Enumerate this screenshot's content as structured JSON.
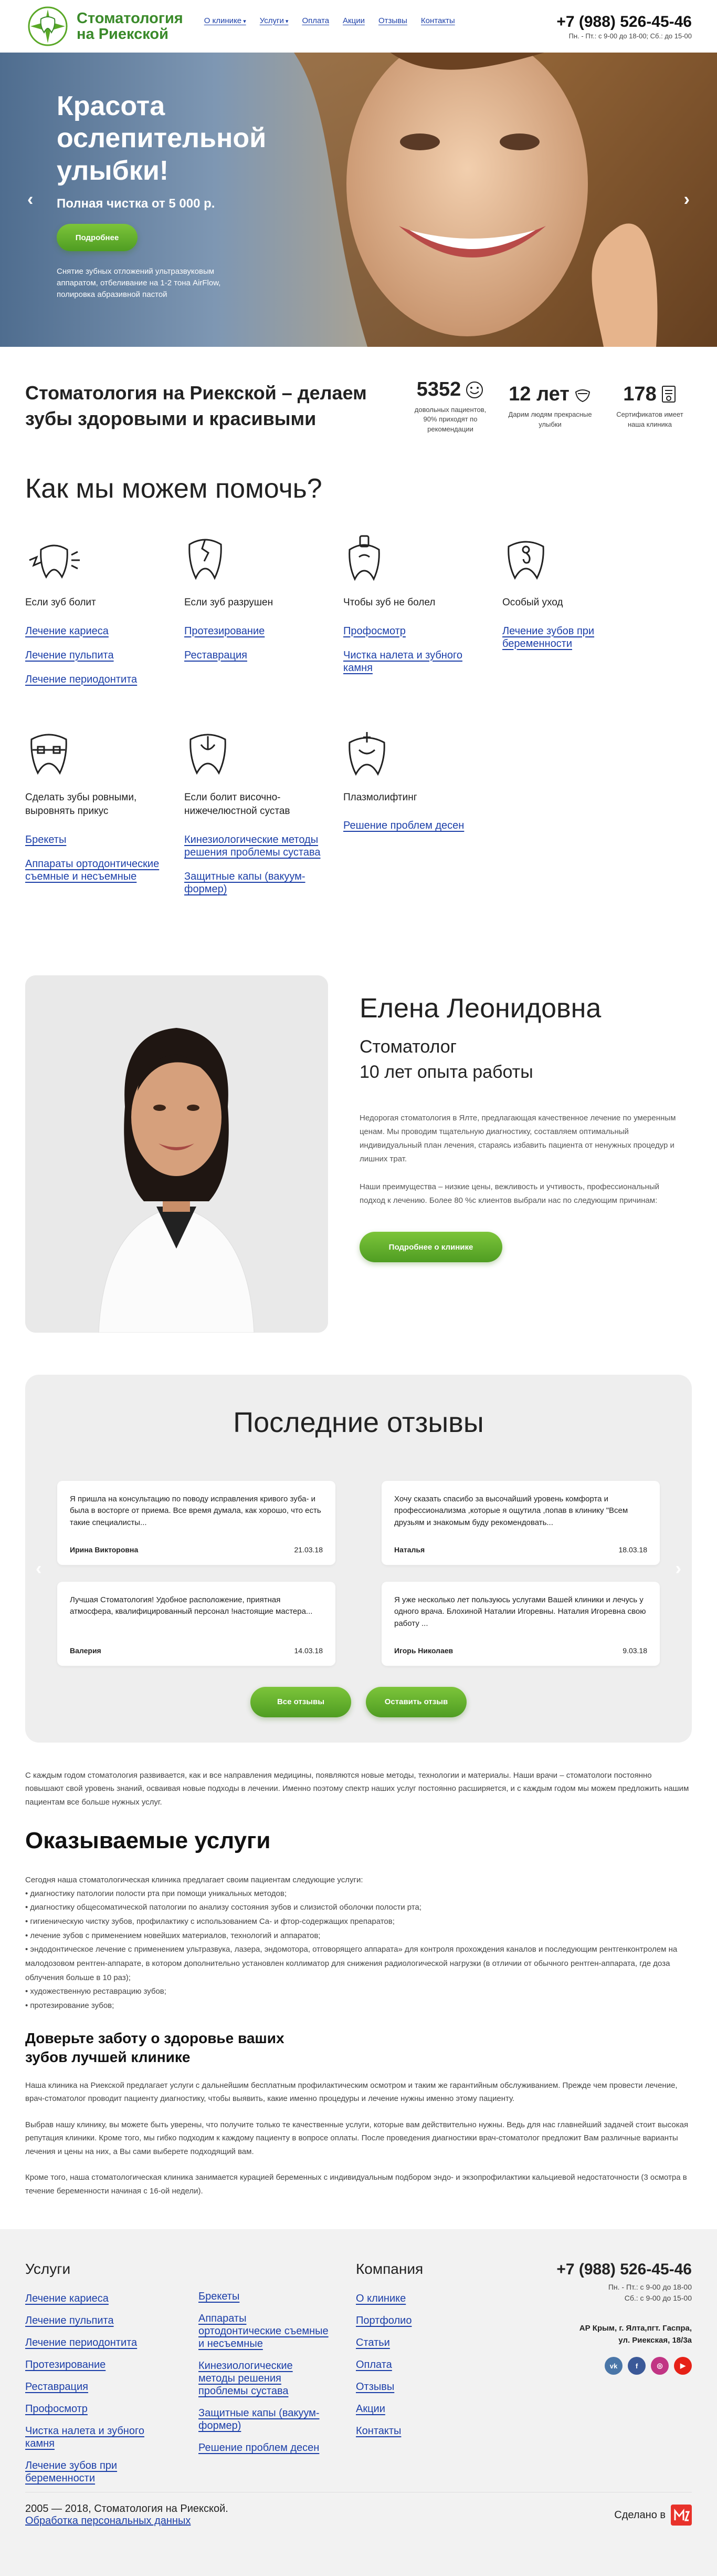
{
  "header": {
    "logo_line1": "Стоматология",
    "logo_line2": "на Риекской",
    "nav": [
      {
        "label": "О клинике",
        "dropdown": true
      },
      {
        "label": "Услуги",
        "dropdown": true
      },
      {
        "label": "Оплата",
        "dropdown": false
      },
      {
        "label": "Акции",
        "dropdown": false
      },
      {
        "label": "Отзывы",
        "dropdown": false
      },
      {
        "label": "Контакты",
        "dropdown": false
      }
    ],
    "phone": "+7 (988) 526-45-46",
    "hours": "Пн. - Пт.: с 9-00 до 18-00; Сб.: до 15-00"
  },
  "hero": {
    "title": "Красота ослепительной улыбки!",
    "subtitle": "Полная чистка от 5 000 р.",
    "button": "Подробнее",
    "description": "Снятие зубных отложений ультразвуковым аппаратом, отбеливание на 1-2 тона AirFlow, полировка абразивной пастой",
    "arrow_left": "‹",
    "arrow_right": "›"
  },
  "stats": {
    "heading": "Стоматология на Риекской – делаем зубы здоровыми и красивыми",
    "items": [
      {
        "num": "5352",
        "caption": "довольных пациентов, 90% приходят по рекомендации"
      },
      {
        "num": "12 лет",
        "caption": "Дарим людям прекрасные улыбки"
      },
      {
        "num": "178",
        "caption": "Сертификатов имеет наша клиника"
      }
    ]
  },
  "help": {
    "heading": "Как мы можем помочь?",
    "items": [
      {
        "title": "Если зуб болит",
        "icon": "tooth-pain-icon",
        "links": [
          "Лечение кариеса",
          "Лечение пульпита",
          "Лечение периодонтита"
        ]
      },
      {
        "title": "Если зуб разрушен",
        "icon": "broken-tooth-icon",
        "links": [
          "Протезирование",
          "Реставрация"
        ]
      },
      {
        "title": "Чтобы зуб не болел",
        "icon": "tooth-care-icon",
        "links": [
          "Профосмотр",
          "Чистка налета и зубного камня"
        ]
      },
      {
        "title": "Особый уход",
        "icon": "pregnancy-icon",
        "links": [
          "Лечение зубов при беременности"
        ]
      },
      {
        "title": "Сделать зубы ровными, выровнять прикус",
        "icon": "braces-icon",
        "links": [
          "Брекеты",
          "Аппараты ортодонтические съемные и несъемные"
        ]
      },
      {
        "title": "Если болит височно-нижечелюстной сустав",
        "icon": "jaw-icon",
        "links": [
          "Кинезиологические методы решения проблемы сустава",
          "Защитные капы (вакуум-формер)"
        ]
      },
      {
        "title": "Плазмолифтинг",
        "icon": "plasma-icon",
        "links": [
          "Решение проблем десен"
        ]
      }
    ]
  },
  "doctor": {
    "name": "Елена Леонидовна",
    "role": "Стоматолог",
    "experience": "10 лет опыта работы",
    "p1": "Недорогая стоматология в Ялте, предлагающая качественное лечение по умеренным ценам. Мы проводим тщательную диагностику, составляем оптимальный индивидуальный план лечения, стараясь избавить пациента от ненужных процедур и лишних трат.",
    "p2": "Наши преимущества – низкие цены, вежливость и учтивость, профессиональный подход к лечению. Более 80 %с клиентов выбрали нас по следующим причинам:",
    "button": "Подробнее о клинике"
  },
  "reviews": {
    "heading": "Последние отзывы",
    "items": [
      {
        "text": "Я пришла на консультацию по поводу исправления кривого зуба- и была в восторге от приема. Все время думала, как хорошо, что есть такие специалисты...",
        "name": "Ирина Викторовна",
        "date": "21.03.18"
      },
      {
        "text": "Хочу сказать спасибо за высочайший уровень комфорта и профессионализма ,которые я ощутила ,попав в клинику \"Всем друзьям и знакомым буду рекомендовать...",
        "name": "Наталья",
        "date": "18.03.18"
      },
      {
        "text": "Лучшая Стоматология! Удобное расположение, приятная атмосфера, квалифицированный персонал !наcтоящие мастера...",
        "name": "Валерия",
        "date": "14.03.18"
      },
      {
        "text": "Я уже несколько лет пользуюсь услугами Вашей клиники и лечусь у одного врача. Блохиной Наталии Игоревны. Наталия Игоревна свою работу ...",
        "name": "Игорь Николаев",
        "date": "9.03.18"
      }
    ],
    "btn_all": "Все отзывы",
    "btn_leave": "Оставить отзыв"
  },
  "article": {
    "intro": "С каждым годом стоматология развивается, как и все направления медицины, появляются новые методы, технологии и материалы. Наши врачи – стоматологи постоянно повышают свой уровень знаний, осваивая новые подходы в лечении. Именно поэтому спектр наших услуг постоянно расширяется, и с каждым годом мы можем предложить нашим пациентам все больше нужных услуг.",
    "heading": "Оказываемые услуги",
    "list_intro": "Сегодня наша стоматологическая клиника предлагает своим пациентам следующие услуги:",
    "list": [
      "• диагностику патологии полости рта при помощи уникальных методов;",
      "• диагностику общесоматической патологии по анализу состояния зубов и слизистой оболочки полости рта;",
      "• гигиеническую чистку зубов, профилактику с использованием Ca- и фтор-содержащих препаратов;",
      "• лечение зубов с применением новейших материалов, технологий и аппаратов;",
      "• эндодонтическое лечение с применением ультразвука, лазера, эндомотора, отговорящего аппарата» для контроля прохождения каналов и последующим рентгенконтролем на малодозовом рентген-аппарате, в котором дополнительно установлен коллиматор для снижения радиологической нагрузки (в отличии от обычного рентген-аппарата, где доза облучения больше в 10 раз);",
      "• художественную реставрацию зубов;",
      "• протезирование зубов;"
    ],
    "subheading": "Доверьте заботу о здоровье ваших зубов лучшей клинике",
    "p1": "Наша клиника на Риекской предлагает услуги с дальнейшим бесплатным профилактическим осмотром и таким же гарантийным обслуживанием. Прежде чем провести лечение, врач-стоматолог проводит пациенту диагностику, чтобы выявить, какие именно процедуры и лечение нужны именно этому пациенту.",
    "p2": "Выбрав нашу клинику, вы можете быть уверены, что получите только те качественные услуги, которые вам действительно нужны. Ведь для нас главнейший задачей стоит высокая репутация клиники. Кроме того, мы гибко подходим к каждому пациенту в вопросе оплаты. После проведения диагностики врач-стоматолог предложит Вам различные варианты лечения и цены на них, а Вы сами выберете подходящий вам.",
    "p3": "Кроме того, наша стоматологическая клиника занимается курацией беременных с индивидуальным подбором эндо- и экзопрофилактики кальциевой недостаточности (3 осмотра в течение беременности начиная с 16-ой недели)."
  },
  "footer": {
    "services_heading": "Услуги",
    "col1": [
      "Лечение кариеса",
      "Лечение пульпита",
      "Лечение периодонтита",
      "Протезирование",
      "Реставрация",
      "Профосмотр",
      "Чистка налета и зубного камня",
      "Лечение зубов при беременности"
    ],
    "col2": [
      "Брекеты",
      "Аппараты ортодонтические съемные и несъемные",
      "Кинезиологические методы решения проблемы сустава",
      "Защитные капы (вакуум-формер)",
      "Решение проблем десен"
    ],
    "company_heading": "Компания",
    "col3": [
      "О клинике",
      "Портфолио",
      "Статьи",
      "Оплата",
      "Отзывы",
      "Акции",
      "Контакты"
    ],
    "phone": "+7 (988) 526-45-46",
    "hours1": "Пн. - Пт.: с 9-00 до 18-00",
    "hours2": "Сб.: с 9-00 до 15-00",
    "address1": "АР Крым, г. Ялта,пгт. Гаспра,",
    "address2": "ул. Риекская, 18/3а",
    "social": [
      {
        "name": "vk-icon",
        "label": "vk",
        "color": "#4a76a8"
      },
      {
        "name": "facebook-icon",
        "label": "f",
        "color": "#3b5998"
      },
      {
        "name": "instagram-icon",
        "label": "◎",
        "color": "#c13584"
      },
      {
        "name": "youtube-icon",
        "label": "▶",
        "color": "#e62117"
      }
    ],
    "copyright": "2005 — 2018, Стоматология на Риекской.",
    "privacy": "Обработка персональных данных",
    "made_by": "Сделано в"
  },
  "colors": {
    "accent_green": "#5aa827",
    "link_blue": "#1c3fa8"
  }
}
